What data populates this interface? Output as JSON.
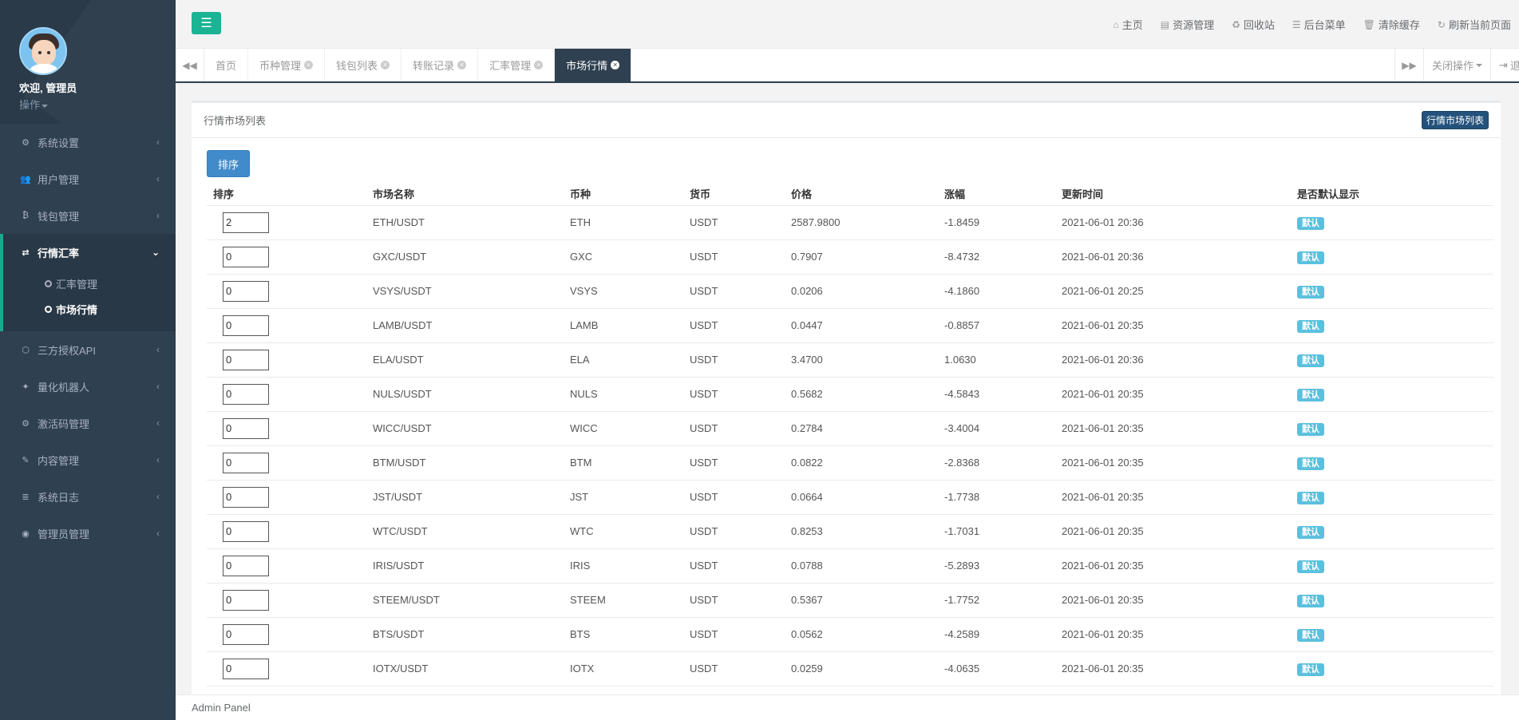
{
  "profile": {
    "welcome": "欢迎, 管理员",
    "operation": "操作"
  },
  "sidebar": {
    "items": [
      {
        "icon": "gears-icon",
        "label": "系统设置"
      },
      {
        "icon": "users-icon",
        "label": "用户管理"
      },
      {
        "icon": "bitcoin-icon",
        "label": "钱包管理"
      },
      {
        "icon": "exchange-icon",
        "label": "行情汇率",
        "active": true,
        "children": [
          {
            "label": "汇率管理"
          },
          {
            "label": "市场行情",
            "current": true
          }
        ]
      },
      {
        "icon": "cube-icon",
        "label": "三方授权API"
      },
      {
        "icon": "android-icon",
        "label": "量化机器人"
      },
      {
        "icon": "gear-icon",
        "label": "激活码管理"
      },
      {
        "icon": "edit-icon",
        "label": "内容管理"
      },
      {
        "icon": "database-icon",
        "label": "系统日志"
      },
      {
        "icon": "user-circle-icon",
        "label": "管理员管理"
      }
    ]
  },
  "header": {
    "links": [
      {
        "icon": "home-icon",
        "label": "主页"
      },
      {
        "icon": "file-icon",
        "label": "资源管理"
      },
      {
        "icon": "recycle-icon",
        "label": "回收站"
      },
      {
        "icon": "list-icon",
        "label": "后台菜单"
      },
      {
        "icon": "trash-icon",
        "label": "清除缓存"
      },
      {
        "icon": "refresh-icon",
        "label": "刷新当前页面"
      }
    ]
  },
  "tabs": {
    "items": [
      {
        "label": "首页",
        "closable": false
      },
      {
        "label": "币种管理",
        "closable": true
      },
      {
        "label": "钱包列表",
        "closable": true
      },
      {
        "label": "转账记录",
        "closable": true
      },
      {
        "label": "汇率管理",
        "closable": true
      },
      {
        "label": "市场行情",
        "closable": true,
        "active": true
      }
    ],
    "close_ops": "关闭操作",
    "logout": "退出"
  },
  "panel": {
    "title": "行情市场列表",
    "badge": "行情市场列表",
    "sort_button": "排序"
  },
  "table": {
    "headers": [
      "排序",
      "市场名称",
      "币种",
      "货币",
      "价格",
      "涨幅",
      "更新时间",
      "是否默认显示"
    ],
    "rows": [
      {
        "sort": "2",
        "market": "ETH/USDT",
        "coin": "ETH",
        "currency": "USDT",
        "price": "2587.9800",
        "change": "-1.8459",
        "time": "2021-06-01 20:36",
        "default": "默认"
      },
      {
        "sort": "0",
        "market": "GXC/USDT",
        "coin": "GXC",
        "currency": "USDT",
        "price": "0.7907",
        "change": "-8.4732",
        "time": "2021-06-01 20:36",
        "default": "默认"
      },
      {
        "sort": "0",
        "market": "VSYS/USDT",
        "coin": "VSYS",
        "currency": "USDT",
        "price": "0.0206",
        "change": "-4.1860",
        "time": "2021-06-01 20:25",
        "default": "默认"
      },
      {
        "sort": "0",
        "market": "LAMB/USDT",
        "coin": "LAMB",
        "currency": "USDT",
        "price": "0.0447",
        "change": "-0.8857",
        "time": "2021-06-01 20:35",
        "default": "默认"
      },
      {
        "sort": "0",
        "market": "ELA/USDT",
        "coin": "ELA",
        "currency": "USDT",
        "price": "3.4700",
        "change": "1.0630",
        "time": "2021-06-01 20:36",
        "default": "默认"
      },
      {
        "sort": "0",
        "market": "NULS/USDT",
        "coin": "NULS",
        "currency": "USDT",
        "price": "0.5682",
        "change": "-4.5843",
        "time": "2021-06-01 20:35",
        "default": "默认"
      },
      {
        "sort": "0",
        "market": "WICC/USDT",
        "coin": "WICC",
        "currency": "USDT",
        "price": "0.2784",
        "change": "-3.4004",
        "time": "2021-06-01 20:35",
        "default": "默认"
      },
      {
        "sort": "0",
        "market": "BTM/USDT",
        "coin": "BTM",
        "currency": "USDT",
        "price": "0.0822",
        "change": "-2.8368",
        "time": "2021-06-01 20:35",
        "default": "默认"
      },
      {
        "sort": "0",
        "market": "JST/USDT",
        "coin": "JST",
        "currency": "USDT",
        "price": "0.0664",
        "change": "-1.7738",
        "time": "2021-06-01 20:35",
        "default": "默认"
      },
      {
        "sort": "0",
        "market": "WTC/USDT",
        "coin": "WTC",
        "currency": "USDT",
        "price": "0.8253",
        "change": "-1.7031",
        "time": "2021-06-01 20:35",
        "default": "默认"
      },
      {
        "sort": "0",
        "market": "IRIS/USDT",
        "coin": "IRIS",
        "currency": "USDT",
        "price": "0.0788",
        "change": "-5.2893",
        "time": "2021-06-01 20:35",
        "default": "默认"
      },
      {
        "sort": "0",
        "market": "STEEM/USDT",
        "coin": "STEEM",
        "currency": "USDT",
        "price": "0.5367",
        "change": "-1.7752",
        "time": "2021-06-01 20:35",
        "default": "默认"
      },
      {
        "sort": "0",
        "market": "BTS/USDT",
        "coin": "BTS",
        "currency": "USDT",
        "price": "0.0562",
        "change": "-4.2589",
        "time": "2021-06-01 20:35",
        "default": "默认"
      },
      {
        "sort": "0",
        "market": "IOTX/USDT",
        "coin": "IOTX",
        "currency": "USDT",
        "price": "0.0259",
        "change": "-4.0635",
        "time": "2021-06-01 20:35",
        "default": "默认"
      }
    ]
  },
  "footer": {
    "text": "Admin Panel"
  },
  "colors": {
    "sidebar_bg": "#2f4050",
    "accent": "#1ab394",
    "primary": "#428bca",
    "info": "#5bc0de",
    "badge": "#23527c"
  }
}
